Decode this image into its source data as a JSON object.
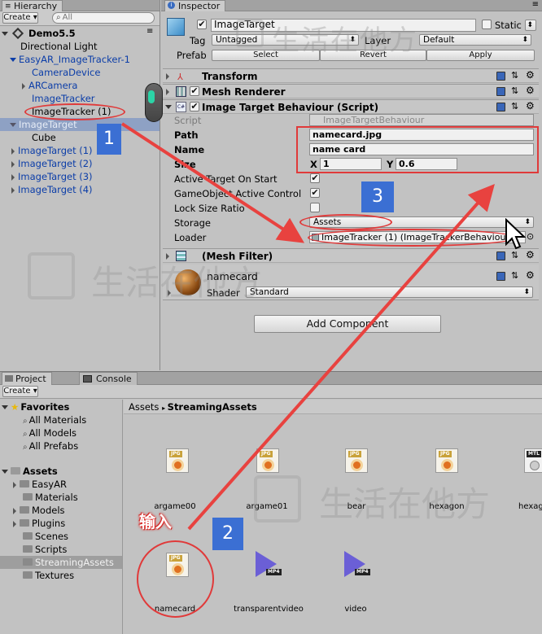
{
  "hierarchy": {
    "tab": "Hierarchy",
    "create": "Create ▾",
    "search_placeholder": "All",
    "scene": "Demo5.5",
    "items": [
      "Directional Light",
      "EasyAR_ImageTracker-1",
      "CameraDevice",
      "ARCamera",
      "ImageTracker",
      "ImageTracker (1)",
      "ImageTarget",
      "Cube",
      "ImageTarget (1)",
      "ImageTarget (2)",
      "ImageTarget (3)",
      "ImageTarget (4)"
    ]
  },
  "inspector": {
    "tab": "Inspector",
    "object_name": "ImageTarget",
    "static_label": "Static",
    "tag_label": "Tag",
    "tag_value": "Untagged",
    "layer_label": "Layer",
    "layer_value": "Default",
    "prefab_label": "Prefab",
    "select": "Select",
    "revert": "Revert",
    "apply": "Apply",
    "transform": "Transform",
    "mesh_renderer": "Mesh Renderer",
    "itb": "Image Target Behaviour (Script)",
    "script_label": "Script",
    "script_value": "ImageTargetBehaviour",
    "path_label": "Path",
    "path_value": "namecard.jpg",
    "name_label": "Name",
    "name_value": "name card",
    "size_label": "Size",
    "x_label": "X",
    "x_value": "1",
    "y_label": "Y",
    "y_value": "0.6",
    "active_target": "Active Target On Start",
    "go_active": "GameObject Active Control",
    "lock_size": "Lock Size Ratio",
    "storage_label": "Storage",
    "storage_value": "Assets",
    "loader_label": "Loader",
    "loader_value": "ImageTracker (1) (ImageTrackerBehaviour)",
    "mesh_filter": "(Mesh Filter)",
    "material_name": "namecard",
    "shader_label": "Shader",
    "shader_value": "Standard",
    "add_component": "Add Component"
  },
  "project": {
    "tab": "Project",
    "console_tab": "Console",
    "create": "Create ▾",
    "favorites": "Favorites",
    "fav_items": [
      "All Materials",
      "All Models",
      "All Prefabs"
    ],
    "assets": "Assets",
    "folders": [
      "EasyAR",
      "Materials",
      "Models",
      "Plugins",
      "Scenes",
      "Scripts",
      "StreamingAssets",
      "Textures"
    ],
    "breadcrumb_root": "Assets",
    "breadcrumb_leaf": "StreamingAssets",
    "files": [
      "argame00",
      "argame01",
      "bear",
      "hexagon",
      "hexag",
      "namecard",
      "transparentvideo",
      "video"
    ],
    "jpg_tag": "JPG",
    "mp4_tag": "MP4",
    "mtl_tag": "MTL"
  },
  "annotations": {
    "n1": "1",
    "n2": "2",
    "n3": "3",
    "input": "输入"
  },
  "watermark": "生活在他方"
}
